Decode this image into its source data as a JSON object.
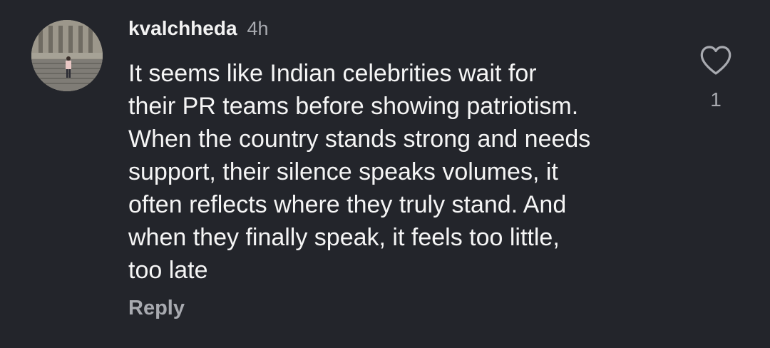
{
  "comment": {
    "username": "kvalchheda",
    "time": "4h",
    "lines": [
      "It seems like Indian celebrities wait for",
      "their PR teams before showing patriotism.",
      "When the country stands strong and needs",
      "support, their silence speaks volumes, it",
      "often reflects where they truly stand. And",
      "when they finally speak, it feels too little,",
      "too late"
    ],
    "reply_label": "Reply",
    "like_count": "1",
    "icons": {
      "like": "heart-outline-icon"
    }
  },
  "colors": {
    "background": "#23252b",
    "primary_text": "#f5f5f5",
    "secondary_text": "#a8aab0"
  }
}
